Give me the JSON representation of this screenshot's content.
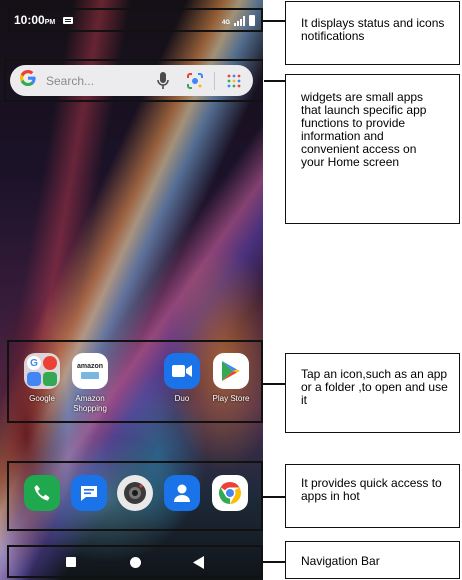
{
  "status_bar": {
    "time": "10:00",
    "ampm": "PM",
    "network": "4G"
  },
  "search": {
    "placeholder": "Search..."
  },
  "apps": [
    {
      "label": "Google"
    },
    {
      "label": "Amazon Shopping",
      "icon_text": "amazon"
    },
    {
      "label": "Duo"
    },
    {
      "label": "Play Store"
    }
  ],
  "dock": [
    "phone-icon",
    "messages-icon",
    "camera-icon",
    "contacts-icon",
    "chrome-icon"
  ],
  "nav": [
    "recents-square-icon",
    "home-circle-icon",
    "back-triangle-icon"
  ],
  "annotations": [
    {
      "text": "It displays status and icons notifications"
    },
    {
      "text": "widgets are small apps that launch specific app functions to provide information and convenient access on your Home screen"
    },
    {
      "text": "Tap an icon,such as an app or a folder ,to open and use it"
    },
    {
      "text": "It provides quick access to apps in hot"
    },
    {
      "text": "Navigation Bar"
    }
  ],
  "colors": {
    "frame": "#111111",
    "phone_green": "#1fa84e",
    "messages_blue": "#1a73e8",
    "duo_blue": "#1a73e8",
    "contacts_blue": "#1a73e8"
  }
}
